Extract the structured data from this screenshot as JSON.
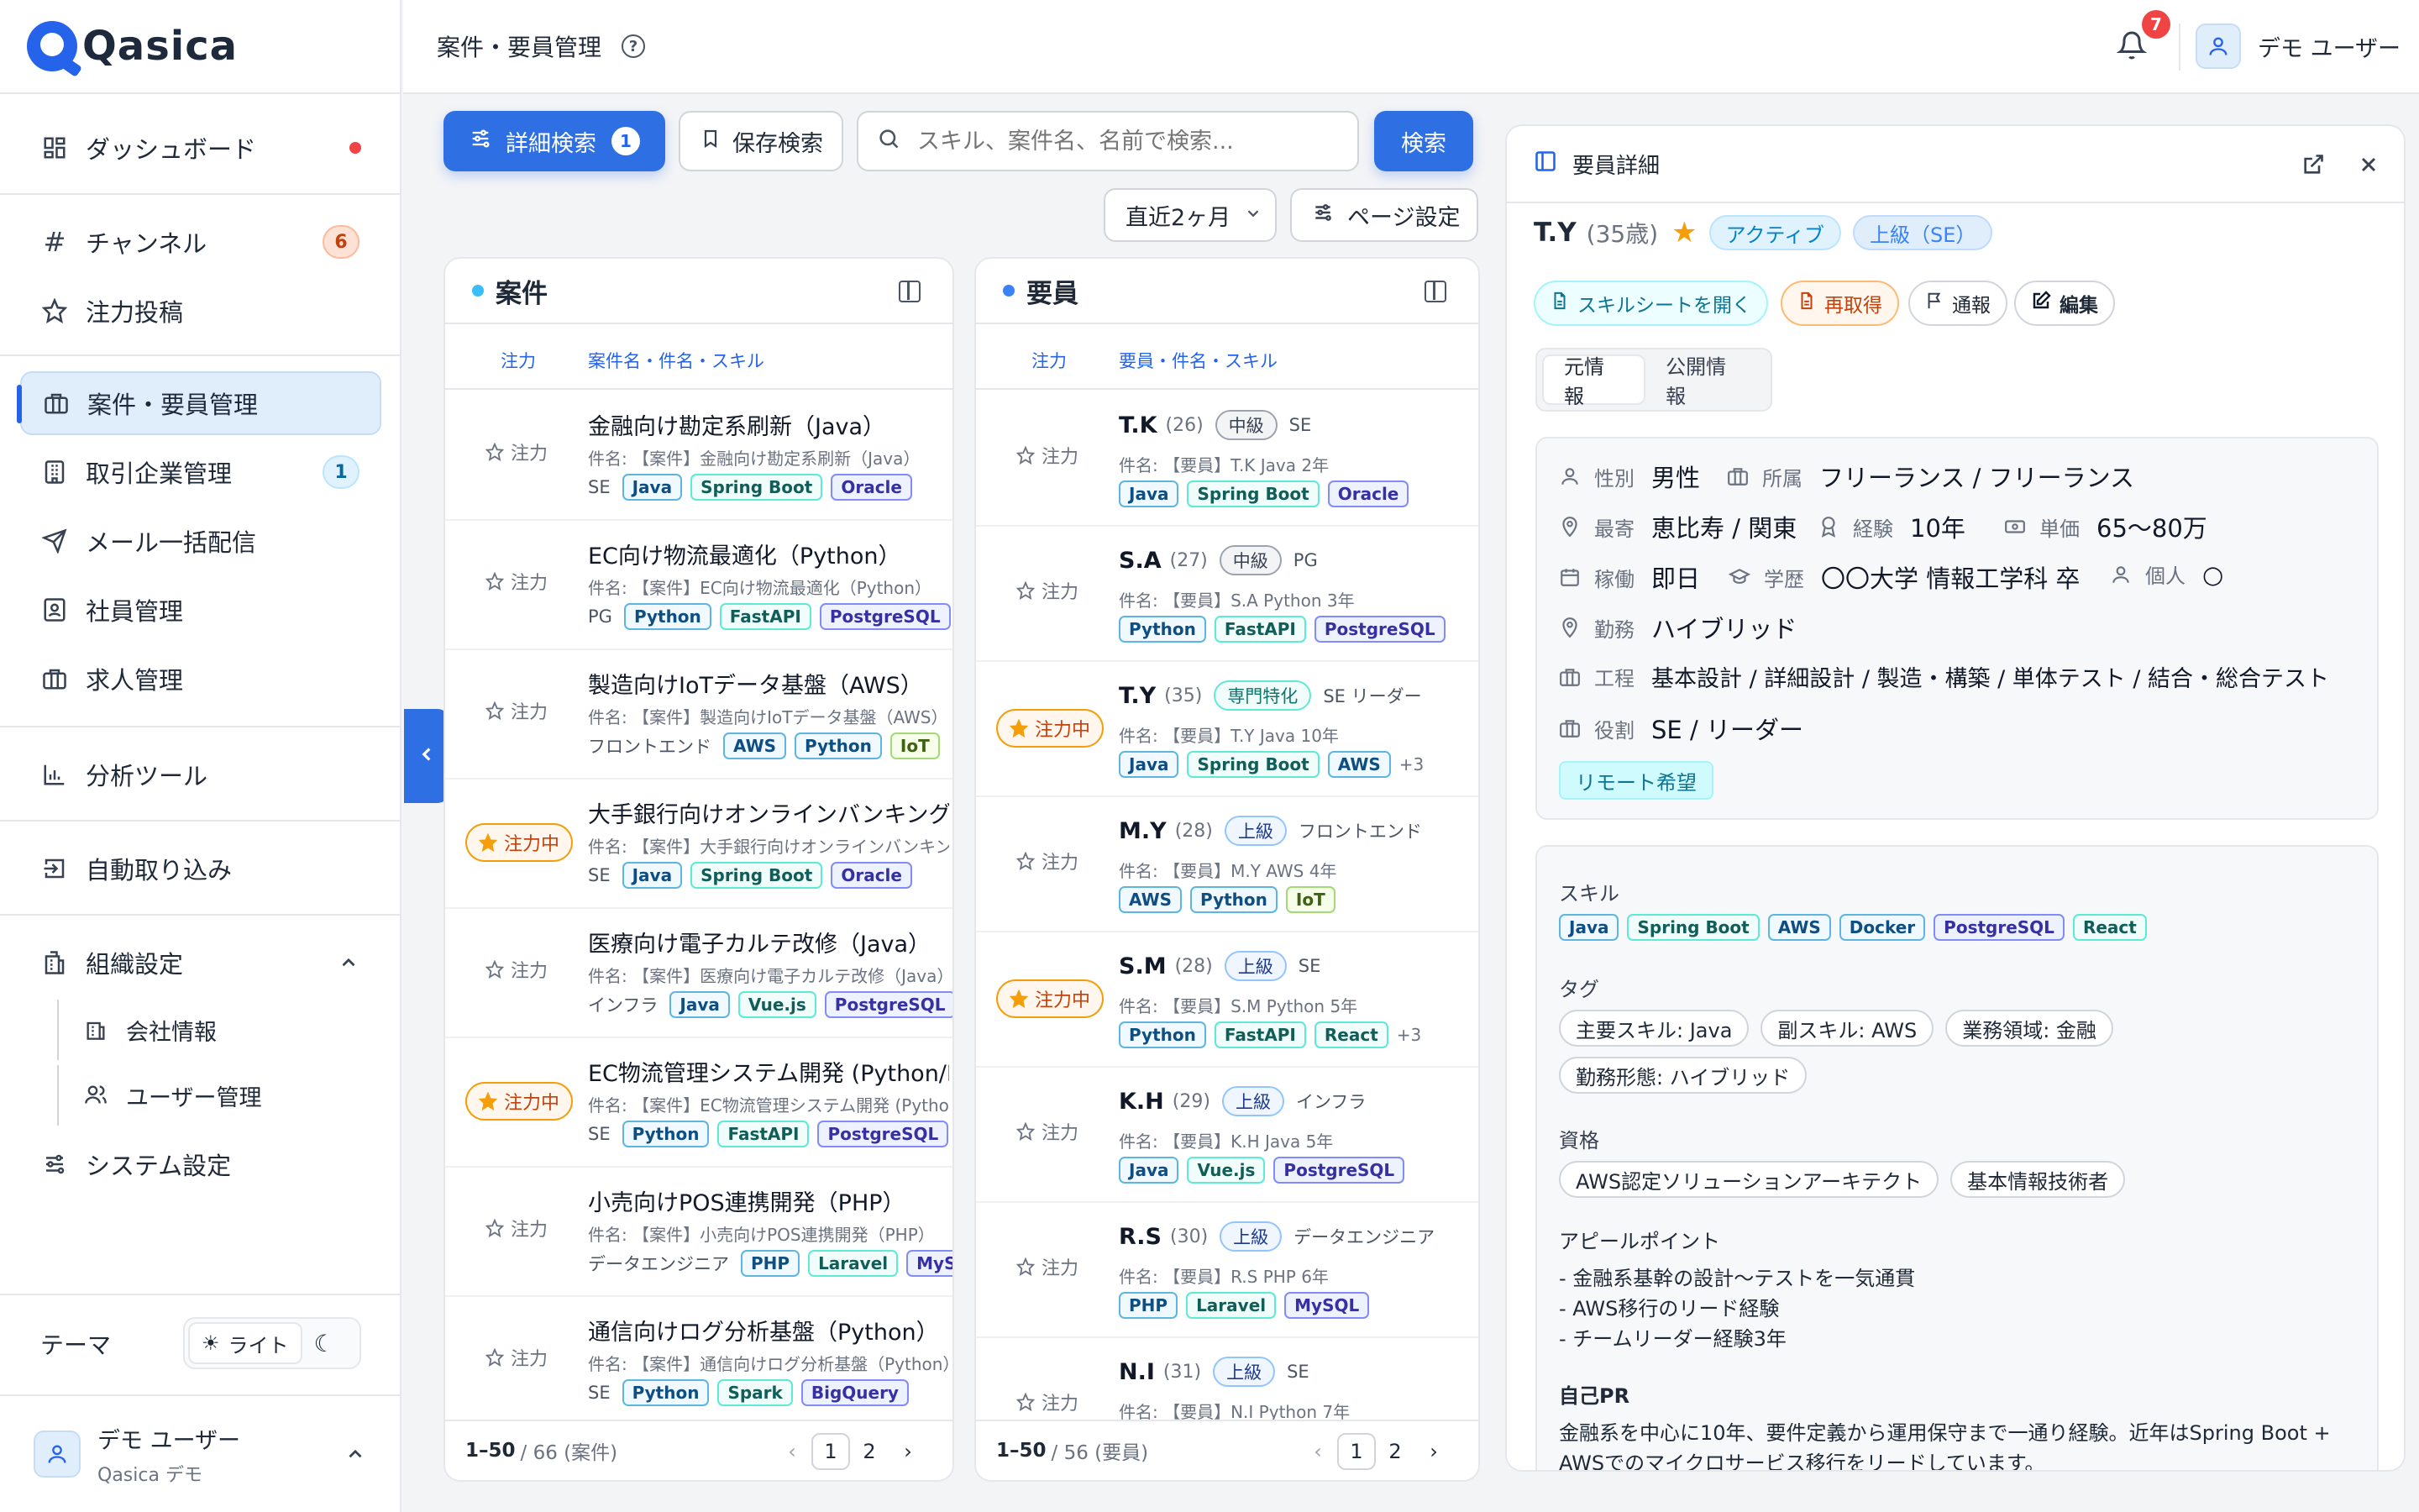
{
  "brand": {
    "name": "Qasica"
  },
  "nav": {
    "dashboard": "ダッシュボード",
    "channels": "チャンネル",
    "channels_badge": "6",
    "focus_posts": "注力投稿",
    "projects": "案件・要員管理",
    "partners": "取引企業管理",
    "partners_badge": "1",
    "mail": "メール一括配信",
    "staff": "社員管理",
    "jobs": "求人管理",
    "analytics": "分析ツール",
    "auto_import": "自動取り込み",
    "org": "組織設定",
    "company": "会社情報",
    "users": "ユーザー管理",
    "system": "システム設定"
  },
  "theme": {
    "label": "テーマ",
    "light": "ライト"
  },
  "sidebar_user": {
    "name": "デモ ユーザー",
    "org": "Qasica デモ"
  },
  "header": {
    "title": "案件・要員管理",
    "notif_count": "7",
    "user": "デモ ユーザー"
  },
  "search": {
    "advanced": "詳細検索",
    "advanced_count": "1",
    "saved": "保存検索",
    "placeholder": "スキル、案件名、名前で検索...",
    "submit": "検索",
    "period": "直近2ヶ月",
    "page_settings": "ページ設定"
  },
  "projects_panel": {
    "title": "案件",
    "col_focus": "注力",
    "col_main": "案件名・件名・スキル",
    "range": "1–50",
    "total": "/ 66 (案件)",
    "pages": [
      "1",
      "2"
    ],
    "rows": [
      {
        "focus": "注力",
        "on": false,
        "title": "金融向け勘定系刷新（Java）",
        "sub": "件名: 【案件】金融向け勘定系刷新（Java）",
        "role": "SE",
        "tags": [
          "Java",
          "Spring Boot",
          "Oracle"
        ]
      },
      {
        "focus": "注力",
        "on": false,
        "title": "EC向け物流最適化（Python）",
        "sub": "件名: 【案件】EC向け物流最適化（Python）",
        "role": "PG",
        "tags": [
          "Python",
          "FastAPI",
          "PostgreSQL"
        ]
      },
      {
        "focus": "注力",
        "on": false,
        "title": "製造向けIoTデータ基盤（AWS）",
        "sub": "件名: 【案件】製造向けIoTデータ基盤（AWS）",
        "role": "フロントエンド",
        "tags": [
          "AWS",
          "Python",
          "IoT"
        ]
      },
      {
        "focus": "注力中",
        "on": true,
        "title": "大手銀行向けオンラインバンキング刷新",
        "sub": "件名: 【案件】大手銀行向けオンラインバンキング刷新",
        "role": "SE",
        "tags": [
          "Java",
          "Spring Boot",
          "Oracle"
        ]
      },
      {
        "focus": "注力",
        "on": false,
        "title": "医療向け電子カルテ改修（Java）",
        "sub": "件名: 【案件】医療向け電子カルテ改修（Java）",
        "role": "インフラ",
        "tags": [
          "Java",
          "Vue.js",
          "PostgreSQL"
        ]
      },
      {
        "focus": "注力中",
        "on": true,
        "title": "EC物流管理システム開発 (Python/FastAPI)",
        "sub": "件名: 【案件】EC物流管理システム開発 (Python/FastAPI)",
        "role": "SE",
        "tags": [
          "Python",
          "FastAPI",
          "PostgreSQL"
        ]
      },
      {
        "focus": "注力",
        "on": false,
        "title": "小売向けPOS連携開発（PHP）",
        "sub": "件名: 【案件】小売向けPOS連携開発（PHP）",
        "role": "データエンジニア",
        "tags": [
          "PHP",
          "Laravel",
          "MySQL"
        ]
      },
      {
        "focus": "注力",
        "on": false,
        "title": "通信向けログ分析基盤（Python）",
        "sub": "件名: 【案件】通信向けログ分析基盤（Python）",
        "role": "SE",
        "tags": [
          "Python",
          "Spark",
          "BigQuery"
        ]
      }
    ]
  },
  "staff_panel": {
    "title": "要員",
    "col_focus": "注力",
    "col_main": "要員・件名・スキル",
    "range": "1–50",
    "total": "/ 56 (要員)",
    "pages": [
      "1",
      "2"
    ],
    "rows": [
      {
        "focus": "注力",
        "on": false,
        "name": "T.K",
        "age": "(26)",
        "level": "中級",
        "lvl": "gray",
        "role": "SE",
        "sub": "件名: 【要員】T.K Java 2年",
        "tags": [
          "Java",
          "Spring Boot",
          "Oracle"
        ],
        "more": ""
      },
      {
        "focus": "注力",
        "on": false,
        "name": "S.A",
        "age": "(27)",
        "level": "中級",
        "lvl": "gray",
        "role": "PG",
        "sub": "件名: 【要員】S.A Python 3年",
        "tags": [
          "Python",
          "FastAPI",
          "PostgreSQL"
        ],
        "more": ""
      },
      {
        "focus": "注力中",
        "on": true,
        "name": "T.Y",
        "age": "(35)",
        "level": "専門特化",
        "lvl": "teal",
        "role": "SE リーダー",
        "sub": "件名: 【要員】T.Y Java 10年",
        "tags": [
          "Java",
          "Spring Boot",
          "AWS"
        ],
        "more": "+3"
      },
      {
        "focus": "注力",
        "on": false,
        "name": "M.Y",
        "age": "(28)",
        "level": "上級",
        "lvl": "blue",
        "role": "フロントエンド",
        "sub": "件名: 【要員】M.Y AWS 4年",
        "tags": [
          "AWS",
          "Python",
          "IoT"
        ],
        "more": ""
      },
      {
        "focus": "注力中",
        "on": true,
        "name": "S.M",
        "age": "(28)",
        "level": "上級",
        "lvl": "blue",
        "role": "SE",
        "sub": "件名: 【要員】S.M Python 5年",
        "tags": [
          "Python",
          "FastAPI",
          "React"
        ],
        "more": "+3"
      },
      {
        "focus": "注力",
        "on": false,
        "name": "K.H",
        "age": "(29)",
        "level": "上級",
        "lvl": "blue",
        "role": "インフラ",
        "sub": "件名: 【要員】K.H Java 5年",
        "tags": [
          "Java",
          "Vue.js",
          "PostgreSQL"
        ],
        "more": ""
      },
      {
        "focus": "注力",
        "on": false,
        "name": "R.S",
        "age": "(30)",
        "level": "上級",
        "lvl": "blue",
        "role": "データエンジニア",
        "sub": "件名: 【要員】R.S PHP 6年",
        "tags": [
          "PHP",
          "Laravel",
          "MySQL"
        ],
        "more": ""
      },
      {
        "focus": "注力",
        "on": false,
        "name": "N.I",
        "age": "(31)",
        "level": "上級",
        "lvl": "blue",
        "role": "SE",
        "sub": "件名: 【要員】N.I Python 7年",
        "tags": [],
        "more": ""
      }
    ]
  },
  "detail": {
    "title": "要員詳細",
    "name": "T.Y",
    "age": "(35歳)",
    "status": "アクティブ",
    "level": "上級（SE）",
    "actions": {
      "open_sheet": "スキルシートを開く",
      "refetch": "再取得",
      "report": "通報",
      "edit": "編集"
    },
    "tabs": [
      "元情報",
      "公開情報"
    ],
    "info": {
      "gender_label": "性別",
      "gender": "男性",
      "affil_label": "所属",
      "affil": "フリーランス / フリーランス",
      "station_label": "最寄",
      "station": "恵比寿 / 関東",
      "exp_label": "経験",
      "exp": "10年",
      "price_label": "単価",
      "price": "65〜80万",
      "avail_label": "稼働",
      "avail": "即日",
      "edu_label": "学歴",
      "edu": "〇〇大学 情報工学科 卒",
      "indiv_label": "個人",
      "indiv": "○",
      "work_label": "勤務",
      "work": "ハイブリッド",
      "phase_label": "工程",
      "phase": "基本設計 / 詳細設計 / 製造・構築 / 単体テスト / 結合・総合テスト",
      "role_label": "役割",
      "role": "SE / リーダー",
      "remote": "リモート希望"
    },
    "skills_label": "スキル",
    "skills": [
      "Java",
      "Spring Boot",
      "AWS",
      "Docker",
      "PostgreSQL",
      "React"
    ],
    "tags_label": "タグ",
    "tags": [
      "主要スキル: Java",
      "副スキル: AWS",
      "業務領域: 金融",
      "勤務形態: ハイブリッド"
    ],
    "certs_label": "資格",
    "certs": [
      "AWS認定ソリューションアーキテクト",
      "基本情報技術者"
    ],
    "appeal_label": "アピールポイント",
    "appeal": [
      "- 金融系基幹の設計〜テストを一気通貫",
      "- AWS移行のリード経験",
      "- チームリーダー経験3年"
    ],
    "pr_label": "自己PR",
    "pr": [
      "金融系を中心に10年、要件定義から運用保守まで一通り経験。近年はSpring Boot +",
      "AWSでのマイクロサービス移行をリードしています。"
    ]
  }
}
